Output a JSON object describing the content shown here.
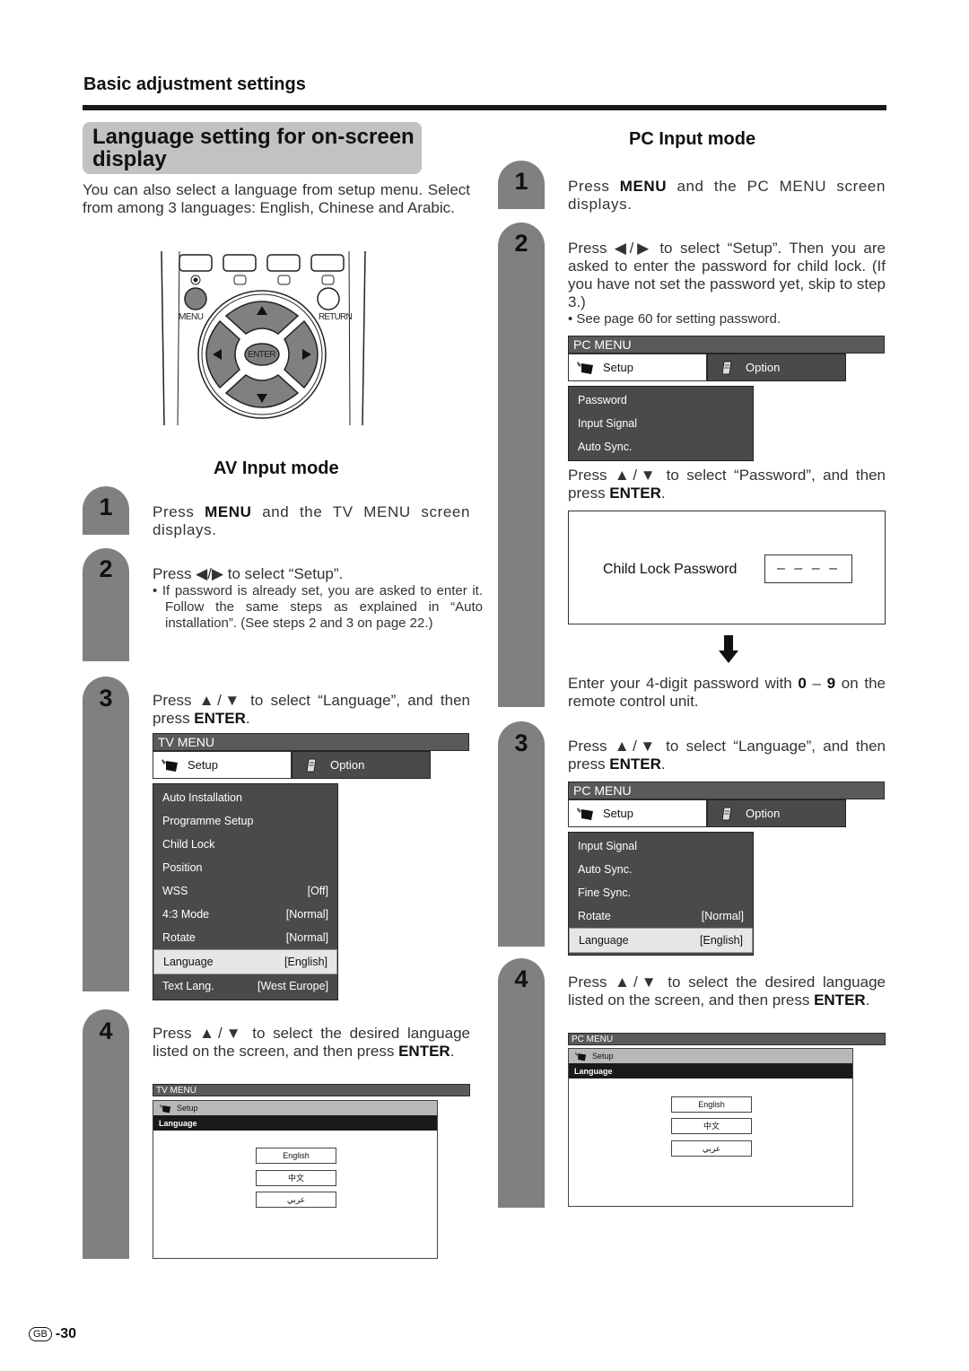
{
  "section_header": "Basic adjustment settings",
  "title": "Language setting for on-screen display",
  "intro": "You can also select a language from setup menu. Select from among 3 languages: English, Chinese and Arabic.",
  "remote": {
    "menu_label": "MENU",
    "return_label": "RETURN",
    "enter_label": "ENTER",
    "up_glyph": "▲",
    "down_glyph": "▼",
    "left_glyph": "◀",
    "right_glyph": "▶"
  },
  "av": {
    "heading": "AV Input mode",
    "steps": [
      {
        "num": "1",
        "pre": "Press ",
        "bold": "MENU",
        "post": " and the TV MENU screen displays."
      },
      {
        "num": "2",
        "text": "Press ◀/▶ to select “Setup”.",
        "bullet": "• If password is already set, you are asked to enter it. Follow the same steps as explained in “Auto installation”. (See steps 2 and 3 on page 22.)"
      },
      {
        "num": "3",
        "pre": "Press ▲/▼ to select “Language”, and then press ",
        "bold": "ENTER",
        "post": "."
      },
      {
        "num": "4",
        "pre": "Press ▲/▼ to select the desired language listed on the screen, and then press ",
        "bold": "ENTER",
        "post": "."
      }
    ],
    "menu": {
      "title": "TV MENU",
      "tab_setup": "Setup",
      "tab_option": "Option",
      "items": [
        {
          "label": "Auto Installation",
          "value": ""
        },
        {
          "label": "Programme Setup",
          "value": ""
        },
        {
          "label": "Child Lock",
          "value": ""
        },
        {
          "label": "Position",
          "value": ""
        },
        {
          "label": "WSS",
          "value": "[Off]"
        },
        {
          "label": "4:3 Mode",
          "value": "[Normal]"
        },
        {
          "label": "Rotate",
          "value": "[Normal]"
        },
        {
          "label": "Language",
          "value": "[English]",
          "selected": true
        },
        {
          "label": "Text Lang.",
          "value": "[West Europe]"
        }
      ]
    },
    "lang_screen": {
      "title": "TV MENU",
      "setup": "Setup",
      "heading": "Language",
      "options": [
        "English",
        "中文",
        "عربي"
      ]
    }
  },
  "pc": {
    "heading": "PC Input mode",
    "steps": [
      {
        "num": "1",
        "pre": "Press ",
        "bold": "MENU",
        "post": " and the PC MENU screen displays."
      },
      {
        "num": "2",
        "text": "Press ◀/▶ to select “Setup”. Then you are asked to enter the password for child lock. (If you have not set the password yet, skip to step 3.)",
        "bullet": "• See page 60 for setting password.",
        "after_menu_pre": "Press ▲/▼ to select “Password”, and then press ",
        "after_menu_bold": "ENTER",
        "after_menu_post": ".",
        "after_pw_pre": "Enter your 4-digit password with ",
        "after_pw_bold1": "0",
        "after_pw_mid": " – ",
        "after_pw_bold2": "9",
        "after_pw_post": " on the remote control unit."
      },
      {
        "num": "3",
        "pre": "Press ▲/▼ to select “Language”, and then press ",
        "bold": "ENTER",
        "post": "."
      },
      {
        "num": "4",
        "pre": "Press ▲/▼ to select the desired language listed on the screen, and then press ",
        "bold": "ENTER",
        "post": "."
      }
    ],
    "menu1": {
      "title": "PC MENU",
      "tab_setup": "Setup",
      "tab_option": "Option",
      "items": [
        {
          "label": "Password",
          "value": ""
        },
        {
          "label": "Input Signal",
          "value": ""
        },
        {
          "label": "Auto Sync.",
          "value": ""
        }
      ]
    },
    "password": {
      "label": "Child Lock Password",
      "value": "– – – –"
    },
    "menu2": {
      "title": "PC MENU",
      "tab_setup": "Setup",
      "tab_option": "Option",
      "items": [
        {
          "label": "Input Signal",
          "value": ""
        },
        {
          "label": "Auto Sync.",
          "value": ""
        },
        {
          "label": "Fine Sync.",
          "value": ""
        },
        {
          "label": "Rotate",
          "value": "[Normal]"
        },
        {
          "label": "Language",
          "value": "[English]",
          "selected": true
        }
      ]
    },
    "lang_screen": {
      "title": "PC MENU",
      "setup": "Setup",
      "heading": "Language",
      "options": [
        "English",
        "中文",
        "عربي"
      ]
    }
  },
  "footer": {
    "region": "GB",
    "page": "-30"
  }
}
